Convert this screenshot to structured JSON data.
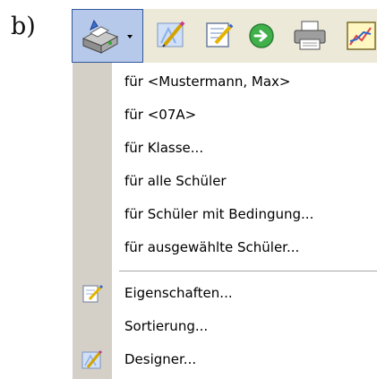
{
  "panel_label": "b)",
  "toolbar": {
    "buttons": [
      {
        "icon": "printer-setup-icon"
      },
      {
        "icon": "designer-icon"
      },
      {
        "icon": "edit-properties-icon"
      },
      {
        "icon": "go-arrow-icon"
      },
      {
        "icon": "printer-icon"
      },
      {
        "icon": "chart-icon"
      }
    ]
  },
  "menu": {
    "items": [
      {
        "label": "für <Mustermann, Max>"
      },
      {
        "label": "für <07A>"
      },
      {
        "label": "für Klasse..."
      },
      {
        "label": "für alle Schüler"
      },
      {
        "label": "für Schüler mit Bedingung..."
      },
      {
        "label": "für ausgewählte Schüler..."
      },
      {
        "label": "Eigenschaften...",
        "icon": "edit-properties-icon"
      },
      {
        "label": "Sortierung..."
      },
      {
        "label": "Designer...",
        "icon": "designer-icon"
      }
    ]
  }
}
